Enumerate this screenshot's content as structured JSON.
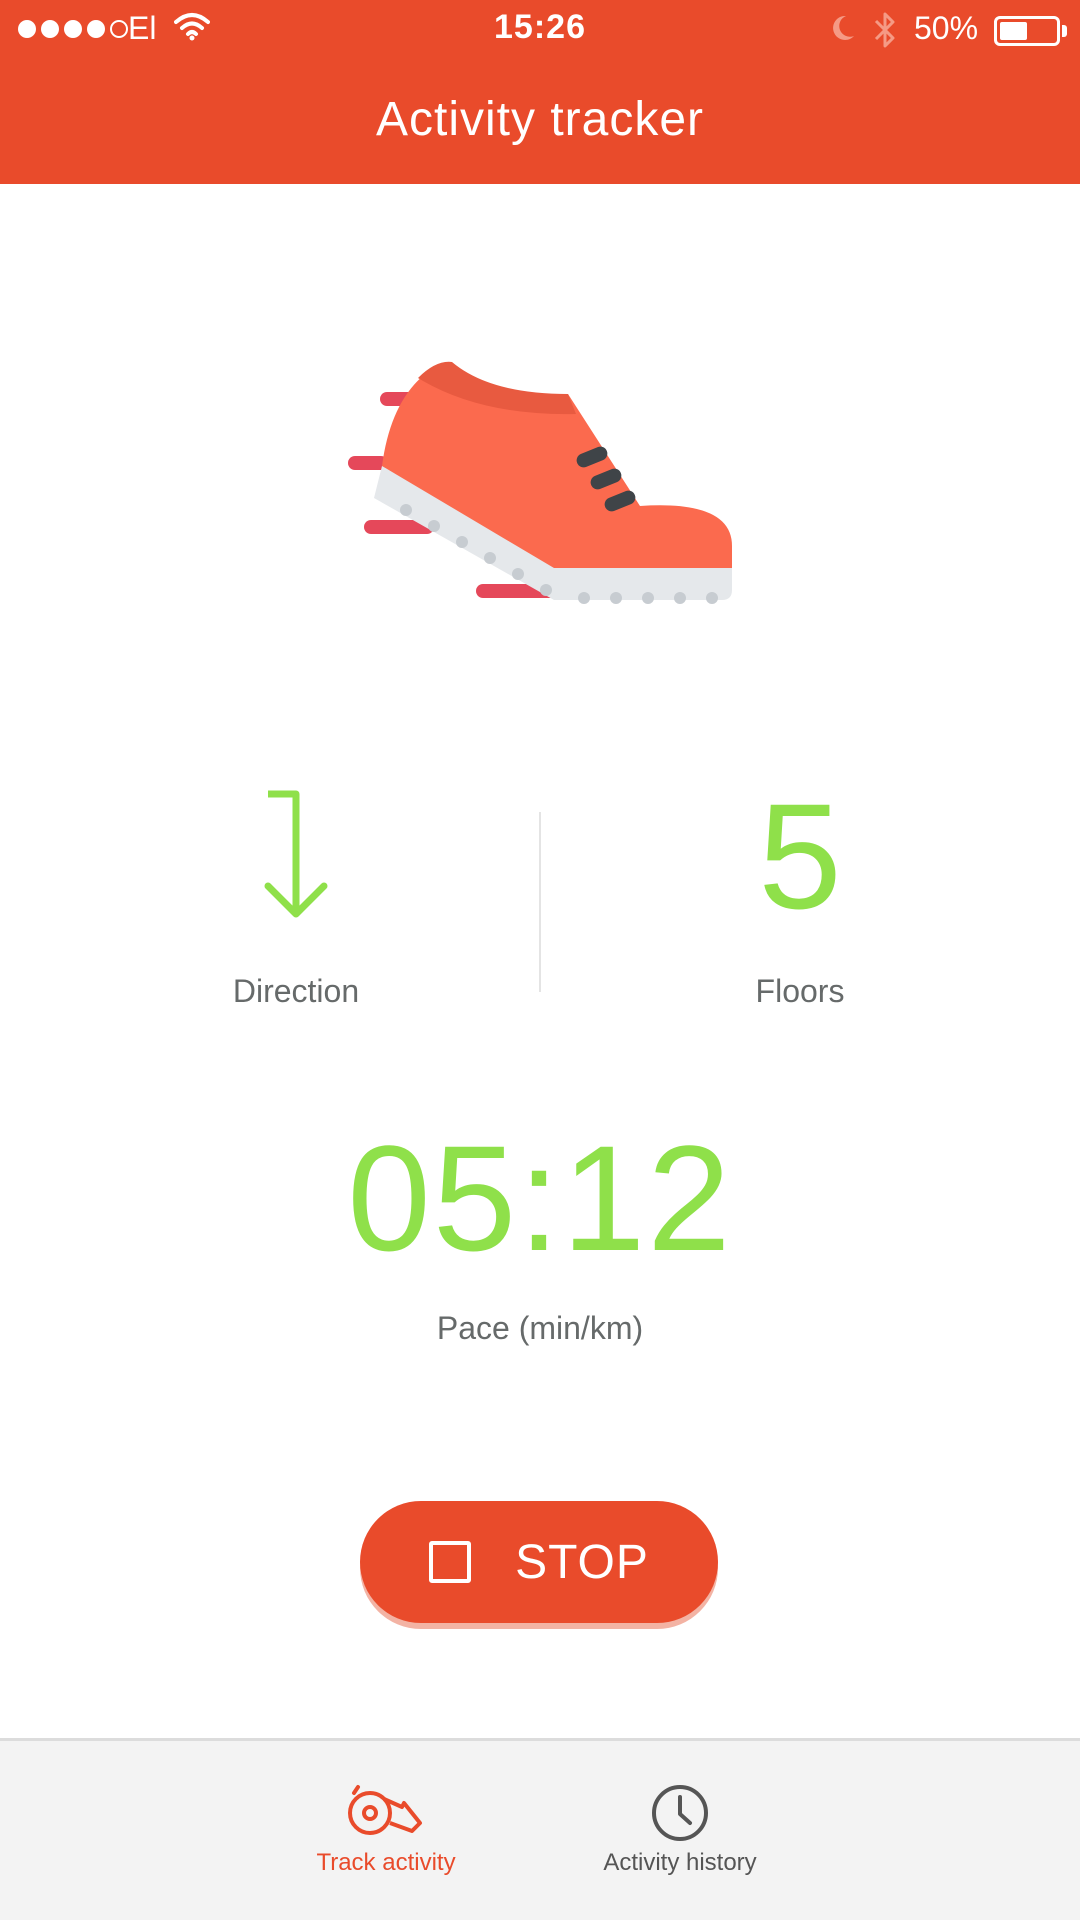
{
  "status_bar": {
    "carrier": "El",
    "time": "15:26",
    "battery_percent": "50%",
    "battery_level": 0.5,
    "signal_bars_filled": 4,
    "signal_bars_total": 5,
    "icons": [
      "wifi-icon",
      "moon-icon",
      "bluetooth-icon",
      "battery-icon"
    ]
  },
  "header": {
    "title": "Activity tracker",
    "background_color": "#e94b2b"
  },
  "hero": {
    "icon": "running-shoe-icon"
  },
  "stats": {
    "direction": {
      "icon": "down-arrow-icon",
      "label": "Direction"
    },
    "floors": {
      "value": "5",
      "label": "Floors"
    },
    "value_color": "#8fe04a"
  },
  "pace": {
    "value": "05:12",
    "label": "Pace (min/km)"
  },
  "stop_button": {
    "icon": "stop-square-icon",
    "label": "STOP"
  },
  "tab_bar": {
    "active_color": "#e94b2b",
    "tabs": [
      {
        "label": "Track activity",
        "icon": "whistle-icon",
        "active": true
      },
      {
        "label": "Activity history",
        "icon": "clock-icon",
        "active": false
      }
    ]
  }
}
